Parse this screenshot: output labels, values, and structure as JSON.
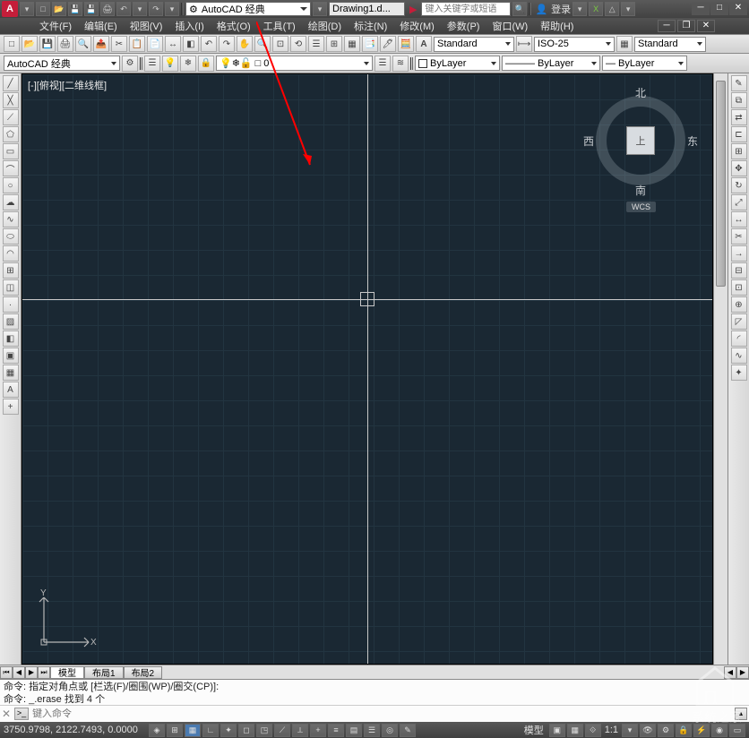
{
  "top": {
    "workspace": "AutoCAD 经典",
    "drawing": "Drawing1.d...",
    "search_placeholder": "键入关键字或短语",
    "login": "登录"
  },
  "menu": {
    "file": "文件(F)",
    "edit": "编辑(E)",
    "view": "视图(V)",
    "insert": "插入(I)",
    "format": "格式(O)",
    "tools": "工具(T)",
    "draw": "绘图(D)",
    "dimension": "标注(N)",
    "modify": "修改(M)",
    "param": "参数(P)",
    "window": "窗口(W)",
    "help": "帮助(H)"
  },
  "toolbar1": {
    "text_style": "Standard",
    "dim_style": "ISO-25",
    "table_style": "Standard"
  },
  "toolbar2": {
    "workspace": "AutoCAD 经典",
    "color": "□ 0",
    "layer": "ByLayer",
    "linetype": "ByLayer",
    "lineweight": "ByLayer"
  },
  "canvas": {
    "view_label": "[-][俯视][二维线框]",
    "compass": {
      "n": "北",
      "s": "南",
      "e": "东",
      "w": "西",
      "cube": "上",
      "wcs": "WCS"
    },
    "ucs": {
      "x": "X",
      "y": "Y"
    }
  },
  "tabs": {
    "model": "模型",
    "layout1": "布局1",
    "layout2": "布局2"
  },
  "cmd": {
    "hist1": "命令: 指定对角点或 [栏选(F)/圈围(WP)/圈交(CP)]:",
    "hist2": "命令: _.erase 找到 4 个",
    "placeholder": "键入命令"
  },
  "status": {
    "coords": "3750.9798, 2122.7493, 0.0000",
    "scale": "1:1"
  },
  "watermark": "系统之家"
}
